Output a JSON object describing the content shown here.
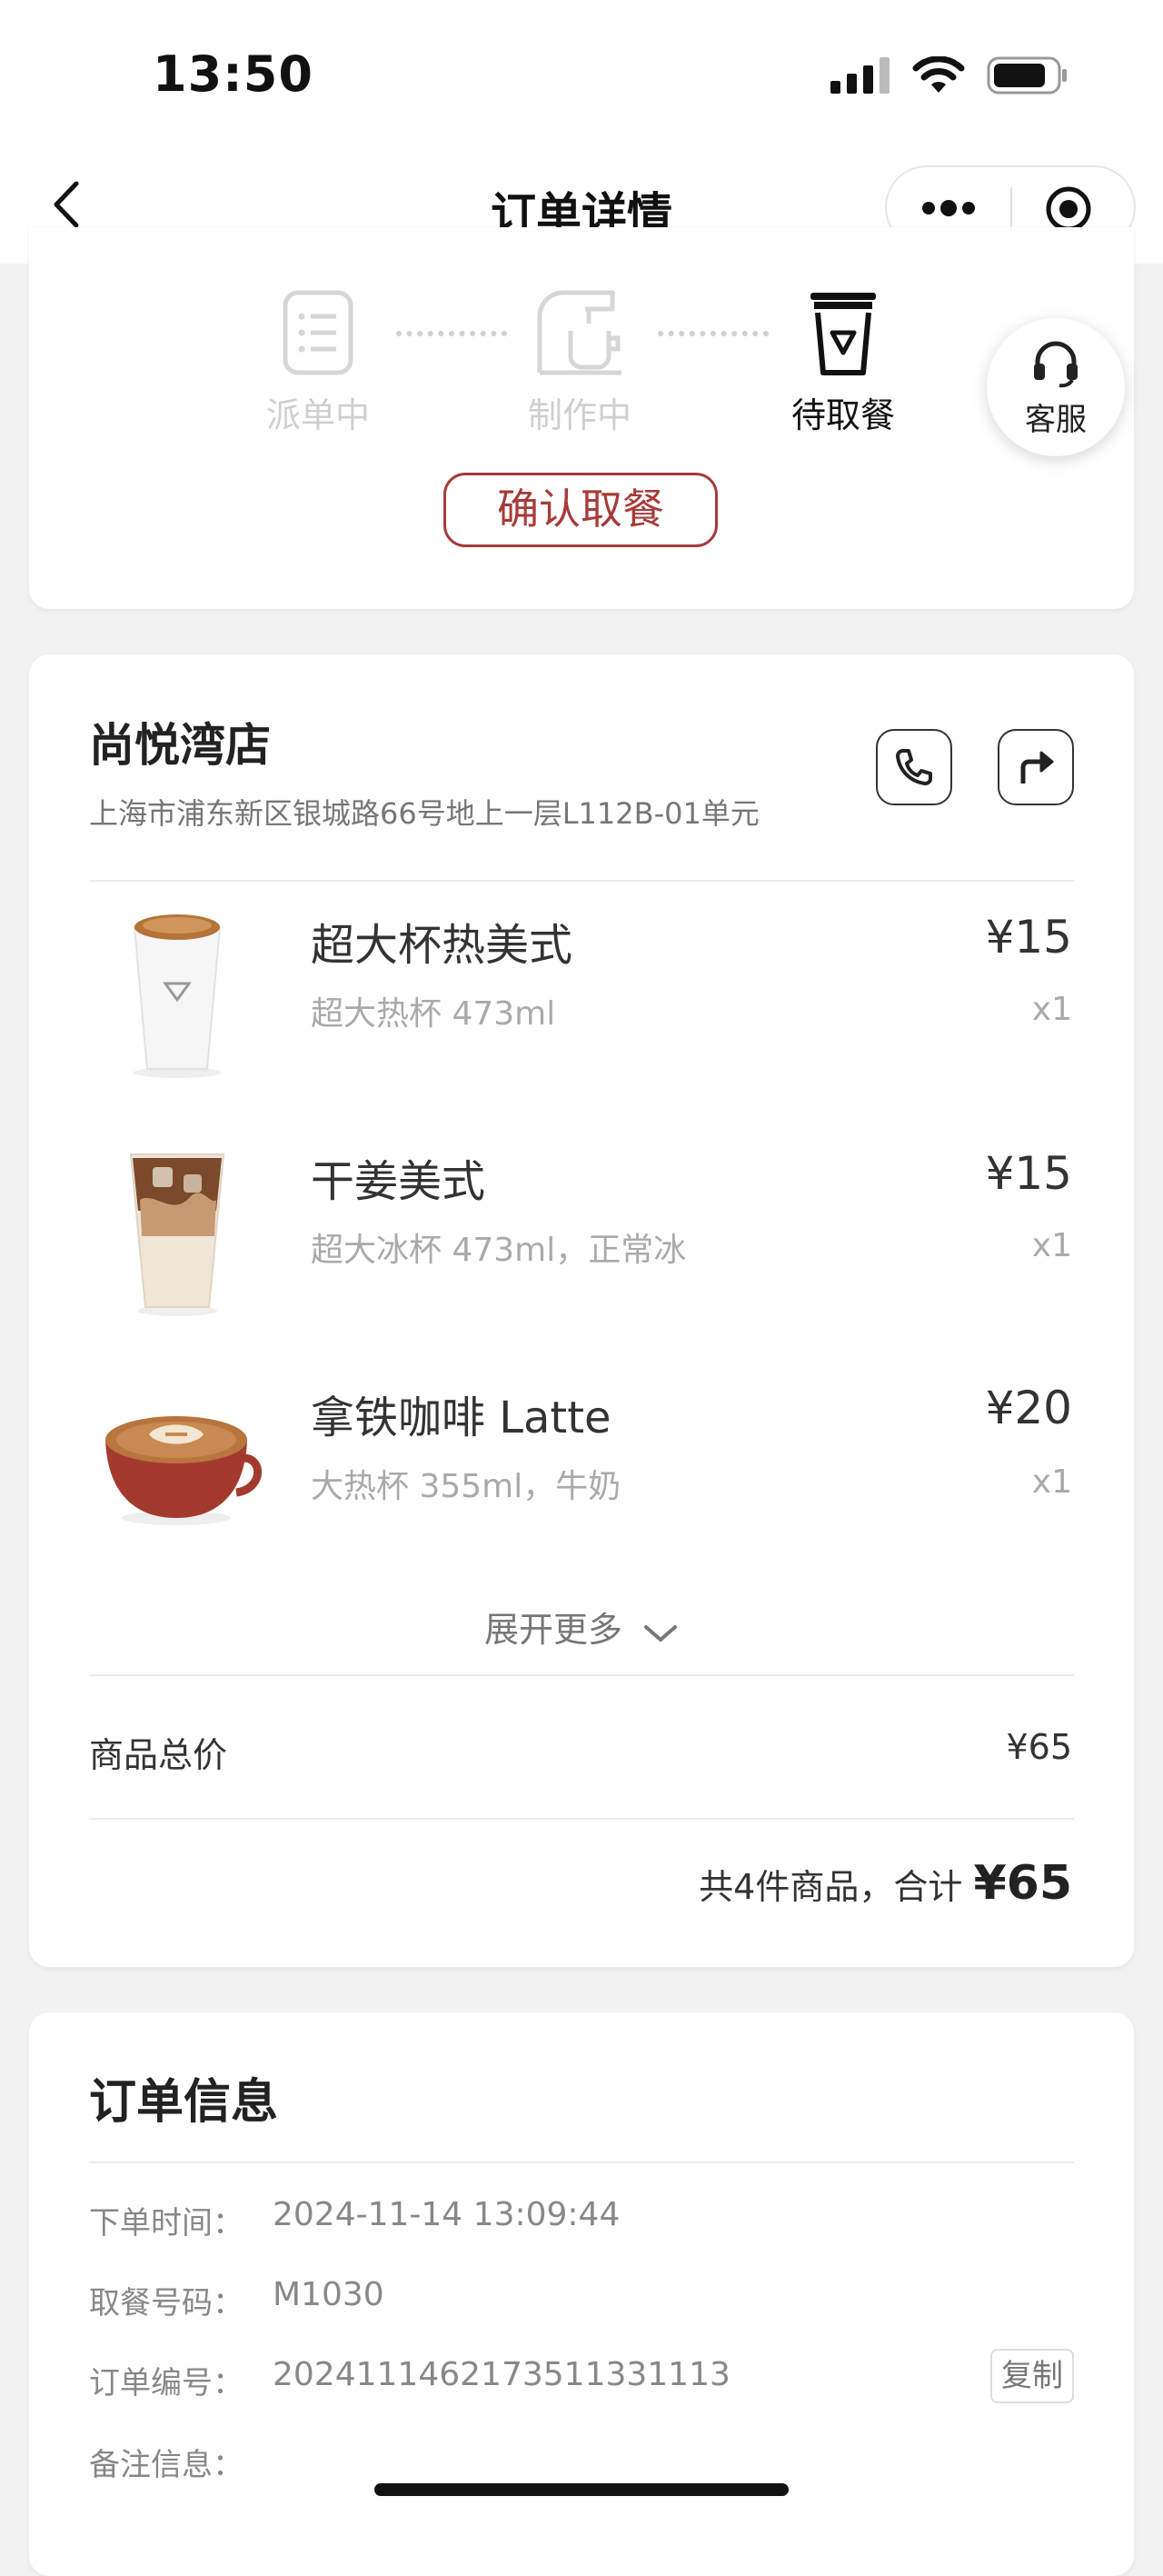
{
  "status": {
    "time": "13:50"
  },
  "nav": {
    "title": "订单详情"
  },
  "progress": {
    "steps": [
      {
        "label": "派单中",
        "active": false
      },
      {
        "label": "制作中",
        "active": false
      },
      {
        "label": "待取餐",
        "active": true
      }
    ],
    "confirm_label": "确认取餐",
    "customer_service": "客服"
  },
  "store": {
    "name": "尚悦湾店",
    "address": "上海市浦东新区银城路66号地上一层L112B-01单元"
  },
  "products": [
    {
      "name": "超大杯热美式",
      "spec": "超大热杯 473ml",
      "price": "¥15",
      "qty": "x1",
      "image": "hot-americano-cup"
    },
    {
      "name": "干姜美式",
      "spec": "超大冰杯 473ml，正常冰",
      "price": "¥15",
      "qty": "x1",
      "image": "iced-ginger-americano"
    },
    {
      "name": "拿铁咖啡 Latte",
      "spec": "大热杯 355ml，牛奶",
      "price": "¥20",
      "qty": "x1",
      "image": "latte-cup"
    }
  ],
  "expand_label": "展开更多",
  "summary": {
    "subtotal_label": "商品总价",
    "subtotal_value": "¥65",
    "total_prefix": "共4件商品，合计",
    "total_value": "¥65"
  },
  "order_info": {
    "title": "订单信息",
    "rows": [
      {
        "label": "下单时间：",
        "value": "2024-11-14 13:09:44"
      },
      {
        "label": "取餐号码：",
        "value": "M1030"
      },
      {
        "label": "订单编号：",
        "value": "2024111462173511331113"
      },
      {
        "label": "备注信息：",
        "value": ""
      }
    ],
    "copy_label": "复制"
  },
  "colors": {
    "accent": "#a83a3a",
    "background": "#f2f2f2"
  }
}
